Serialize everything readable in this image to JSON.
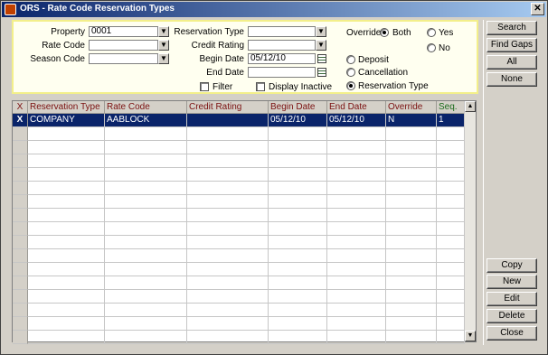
{
  "window": {
    "title": "ORS - Rate Code Reservation Types",
    "close_glyph": "✕",
    "app_icon": "opera-app-icon"
  },
  "search": {
    "property_label": "Property",
    "property_value": "0001",
    "rate_code_label": "Rate Code",
    "rate_code_value": "",
    "season_code_label": "Season Code",
    "season_code_value": "",
    "reservation_type_label": "Reservation Type",
    "reservation_type_value": "",
    "credit_rating_label": "Credit Rating",
    "credit_rating_value": "",
    "begin_date_label": "Begin Date",
    "begin_date_value": "05/12/10",
    "end_date_label": "End Date",
    "end_date_value": "",
    "filter_label": "Filter",
    "filter_checked": false,
    "display_inactive_label": "Display Inactive",
    "display_inactive_checked": false,
    "override_label": "Override",
    "override_options": [
      "Both",
      "Yes",
      "No"
    ],
    "override_selected": "Both",
    "type_options": [
      "Deposit",
      "Cancellation",
      "Reservation Type"
    ],
    "type_selected": "Reservation Type",
    "dropdown_glyph": "▼"
  },
  "grid": {
    "selector_header": "X",
    "columns": [
      "Reservation Type",
      "Rate Code",
      "Credit Rating",
      "Begin Date",
      "End Date",
      "Override",
      "Seq."
    ],
    "rows": [
      {
        "selector": "X",
        "cells": [
          "COMPANY",
          "AABLOCK",
          "",
          "05/12/10",
          "05/12/10",
          "N",
          "1"
        ]
      }
    ],
    "scroll_up_glyph": "▲",
    "scroll_down_glyph": "▼"
  },
  "buttons": {
    "search": "Search",
    "find_gaps": "Find Gaps",
    "all": "All",
    "none": "None",
    "copy": "Copy",
    "new": "New",
    "edit": "Edit",
    "delete": "Delete",
    "close": "Close"
  },
  "colors": {
    "title_bar": "#0a246a",
    "panel_bg": "#fffff0",
    "panel_border": "#f3ef8a",
    "selection": "#0a246a",
    "header_text": "#7a1010"
  }
}
